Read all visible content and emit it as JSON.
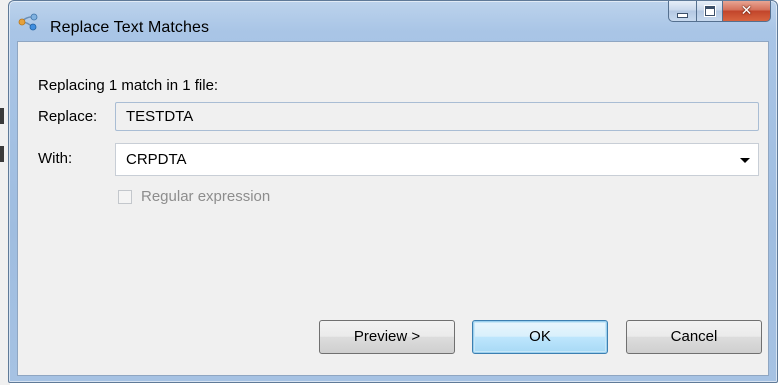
{
  "window": {
    "title": "Replace Text Matches",
    "app_icon": "refactor-icon",
    "caption_buttons": [
      "minimize",
      "maximize",
      "close"
    ]
  },
  "dialog": {
    "info": "Replacing 1 match in 1 file:",
    "replace_label": "Replace:",
    "replace_value": "TESTDTA",
    "with_label": "With:",
    "with_value": "CRPDTA",
    "regex_label": "Regular expression",
    "regex_checked": false,
    "regex_enabled": false
  },
  "buttons": {
    "preview": "Preview >",
    "ok": "OK",
    "cancel": "Cancel"
  },
  "colors": {
    "title_bar": "#a9c5e6",
    "close_button": "#c2452b",
    "default_button": "#3c7fb1",
    "client_bg": "#f0f0f0"
  }
}
